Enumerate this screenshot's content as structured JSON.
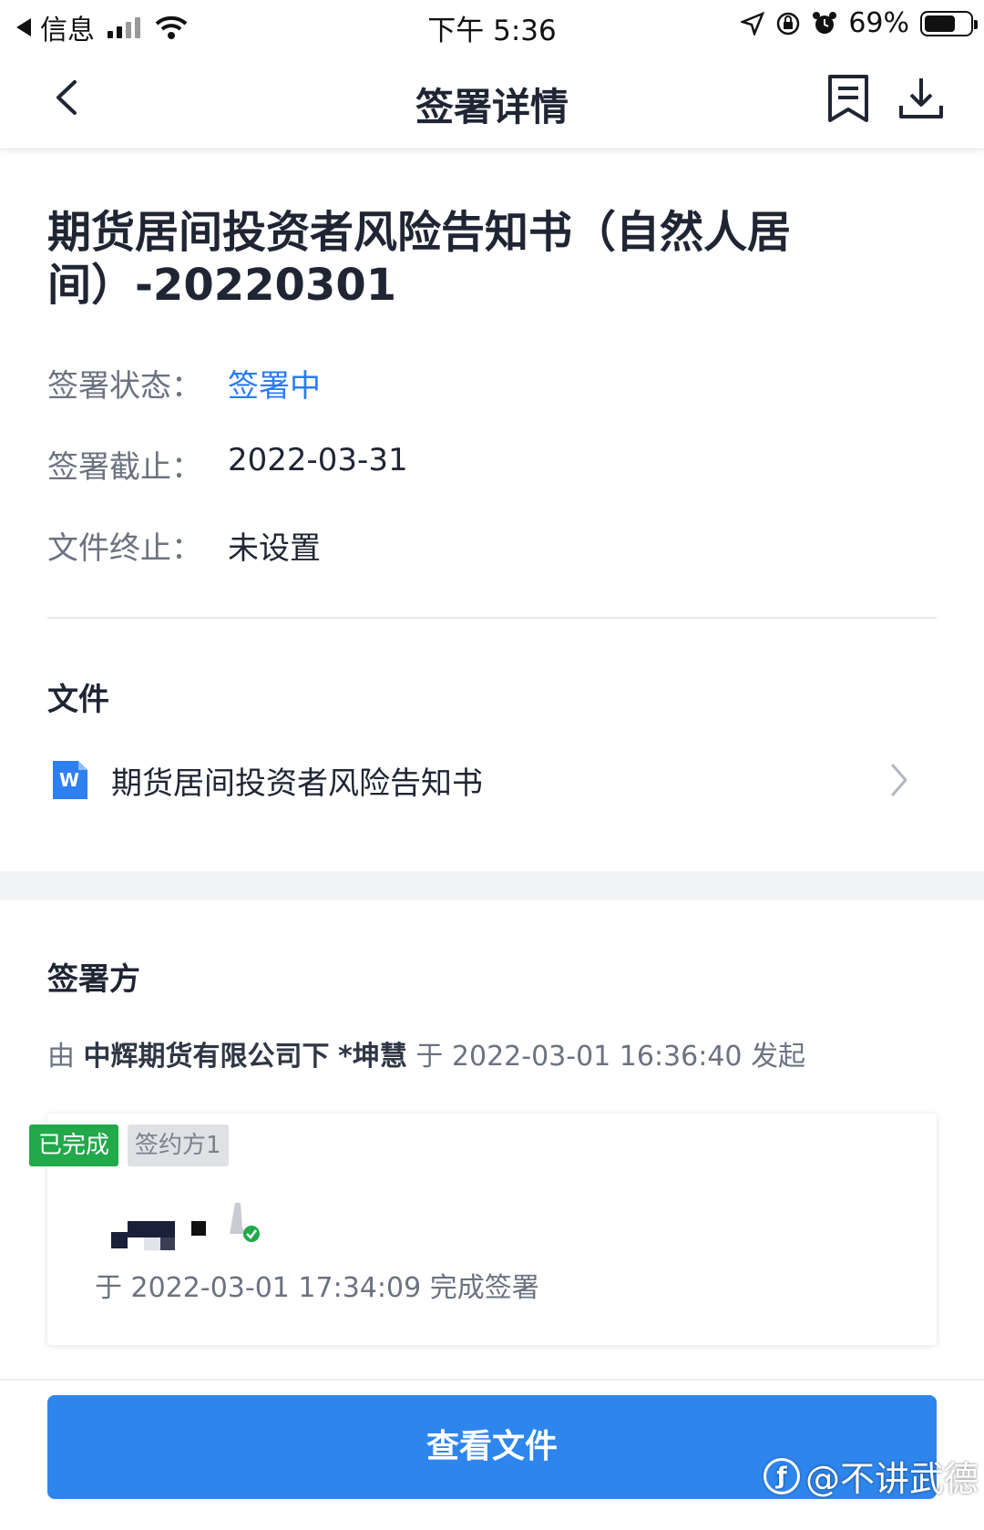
{
  "status_bar": {
    "back_app": "信息",
    "time": "下午 5:36",
    "battery": "69%",
    "battery_level": 0.69
  },
  "nav": {
    "title": "签署详情"
  },
  "document": {
    "title": "期货居间投资者风险告知书（自然人居间）-20220301",
    "fields": [
      {
        "label": "签署状态：",
        "value": "签署中",
        "accent": "#2b7bf0"
      },
      {
        "label": "签署截止：",
        "value": "2022-03-31"
      },
      {
        "label": "文件终止：",
        "value": "未设置"
      }
    ]
  },
  "files_section": {
    "title": "文件",
    "file_icon_letter": "W",
    "file_name": "期货居间投资者风险告知书"
  },
  "signers_section": {
    "title": "签署方",
    "initiator": {
      "prefix": "由",
      "company": "中辉期货有限公司下",
      "person": "*坤慧",
      "at": "于",
      "time": "2022-03-01 16:36:40",
      "suffix": "发起"
    },
    "signer": {
      "status_badge": "已完成",
      "party_badge": "签约方1",
      "completed_text": "于 2022-03-01 17:34:09 完成签署"
    }
  },
  "actions": {
    "view_file_label": "查看文件"
  },
  "watermark": {
    "text": "@不讲武德"
  },
  "colors": {
    "primary": "#2e86ec",
    "status_blue": "#2b7bf0",
    "success_green": "#21a94a"
  }
}
